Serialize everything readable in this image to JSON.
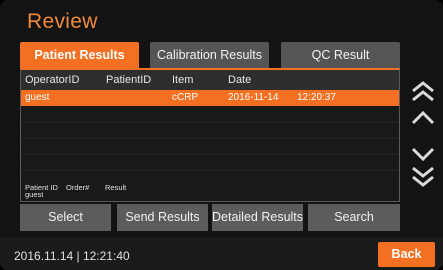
{
  "header": {
    "title": "Review"
  },
  "tabs": [
    {
      "label": "Patient Results",
      "active": true
    },
    {
      "label": "Calibration Results",
      "active": false
    },
    {
      "label": "QC Result",
      "active": false
    }
  ],
  "table": {
    "columns": [
      "OperatorID",
      "PatientID",
      "Item",
      "Date"
    ],
    "rows": [
      {
        "operator_id": "guest",
        "patient_id": "",
        "item": "cCRP",
        "date": "2016-11-14",
        "time": "12:20:37",
        "selected": true
      }
    ]
  },
  "detail": {
    "labels": [
      "Patient ID",
      "Order#",
      "Result"
    ],
    "value": "guest"
  },
  "scroll": {
    "icons": [
      "double-up-icon",
      "up-icon",
      "down-icon",
      "double-down-icon"
    ]
  },
  "actions": [
    "Select",
    "Send Results",
    "Detailed Results",
    "Search"
  ],
  "footer": {
    "datetime": "2016.11.14 | 12:21:40",
    "back_label": "Back"
  },
  "colors": {
    "accent": "#f36f21",
    "title": "#f08a3c",
    "button": "#5c5c5c",
    "background": "#131313"
  }
}
